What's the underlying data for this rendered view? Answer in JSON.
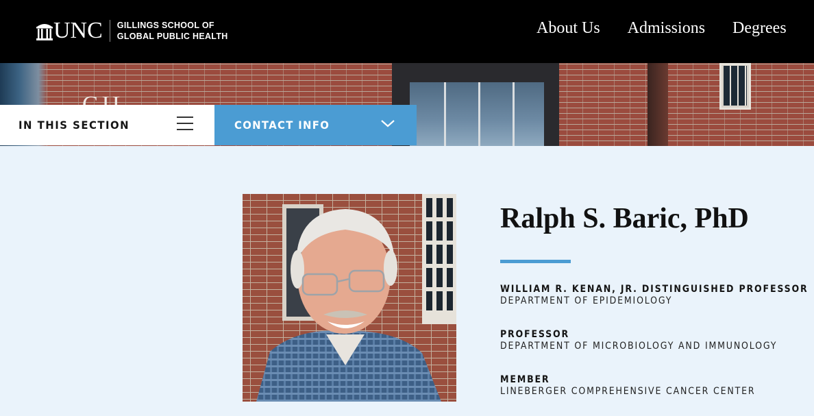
{
  "header": {
    "logo_text": "UNC",
    "school_line1": "GILLINGS SCHOOL OF",
    "school_line2": "GLOBAL PUBLIC HEALTH",
    "nav": [
      "About Us",
      "Admissions",
      "Degrees"
    ]
  },
  "hero": {
    "building_lettering": "GIL"
  },
  "section_bar": {
    "in_this_section": "IN THIS SECTION",
    "contact_info": "CONTACT INFO"
  },
  "profile": {
    "name": "Ralph S. Baric, PhD",
    "roles": [
      {
        "title": "WILLIAM R. KENAN, JR. DISTINGUISHED PROFESSOR",
        "department": "DEPARTMENT OF EPIDEMIOLOGY"
      },
      {
        "title": "PROFESSOR",
        "department": "DEPARTMENT OF MICROBIOLOGY AND IMMUNOLOGY"
      },
      {
        "title": "MEMBER",
        "department": "LINEBERGER COMPREHENSIVE CANCER CENTER"
      }
    ]
  },
  "colors": {
    "accent_blue": "#4b9cd3",
    "header_black": "#000000",
    "page_background": "#eaf3fb"
  },
  "icons": [
    "old-well-icon",
    "hamburger-menu-icon",
    "chevron-down-icon"
  ]
}
